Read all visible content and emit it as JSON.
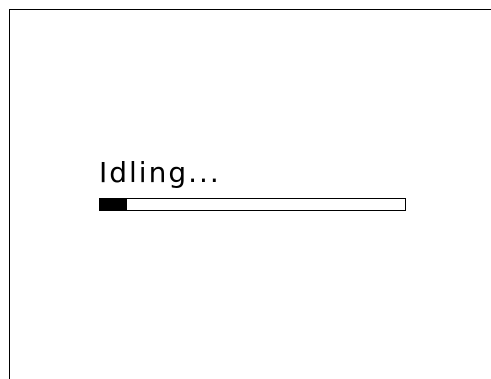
{
  "status": {
    "label": "Idling..."
  },
  "progress": {
    "fraction": 0.09
  },
  "colors": {
    "background": "#ffffff",
    "foreground": "#000000"
  }
}
